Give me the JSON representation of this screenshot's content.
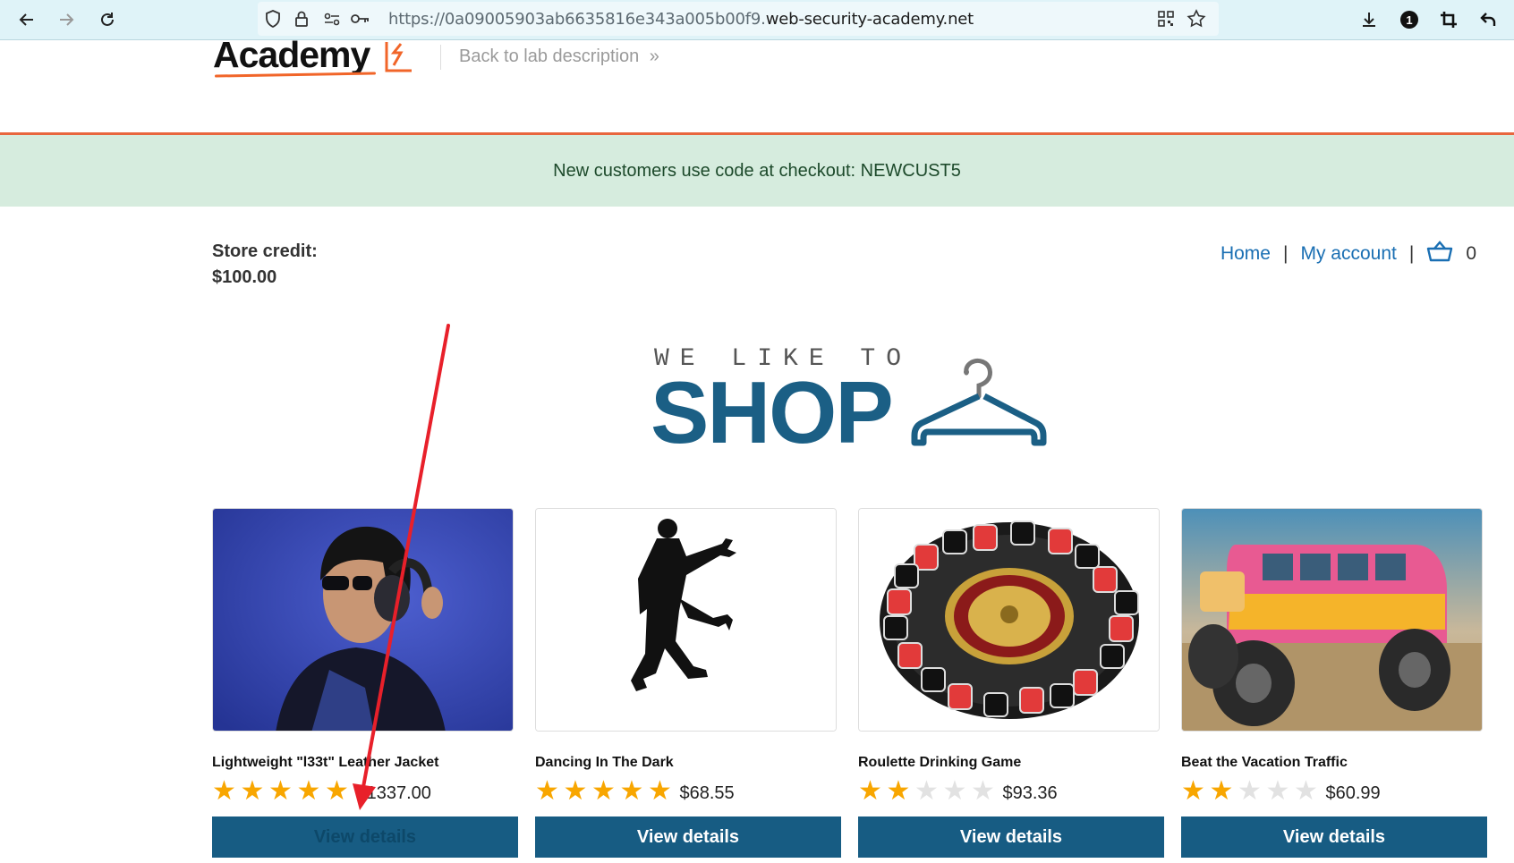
{
  "browser": {
    "url_prefix": "https://0a09005903ab6635816e343a005b00f9.",
    "url_domain": "web-security-academy.net",
    "extension_badge": "1"
  },
  "header": {
    "logo_text": "Academy",
    "back_link": "Back to lab description"
  },
  "banner": {
    "text": "New customers use code at checkout: NEWCUST5"
  },
  "account": {
    "credit_label": "Store credit:",
    "credit_value": "$100.00"
  },
  "nav": {
    "home": "Home",
    "separator": "|",
    "my_account": "My account",
    "cart_count": "0"
  },
  "hero": {
    "tagline": "WE LIKE TO",
    "title": "SHOP"
  },
  "products": [
    {
      "name": "Lightweight \"l33t\" Leather Jacket",
      "rating": 5,
      "price": "$1337.00",
      "button": "View details"
    },
    {
      "name": "Dancing In The Dark",
      "rating": 5,
      "price": "$68.55",
      "button": "View details"
    },
    {
      "name": "Roulette Drinking Game",
      "rating": 2,
      "price": "$93.36",
      "button": "View details"
    },
    {
      "name": "Beat the Vacation Traffic",
      "rating": 2,
      "price": "$60.99",
      "button": "View details"
    }
  ],
  "colors": {
    "accent_orange": "#e8663e",
    "banner_bg": "#d6ecde",
    "button_blue": "#175c83",
    "link_blue": "#1a6fb3",
    "star": "#f8a600",
    "annotation_red": "#e8202a"
  }
}
